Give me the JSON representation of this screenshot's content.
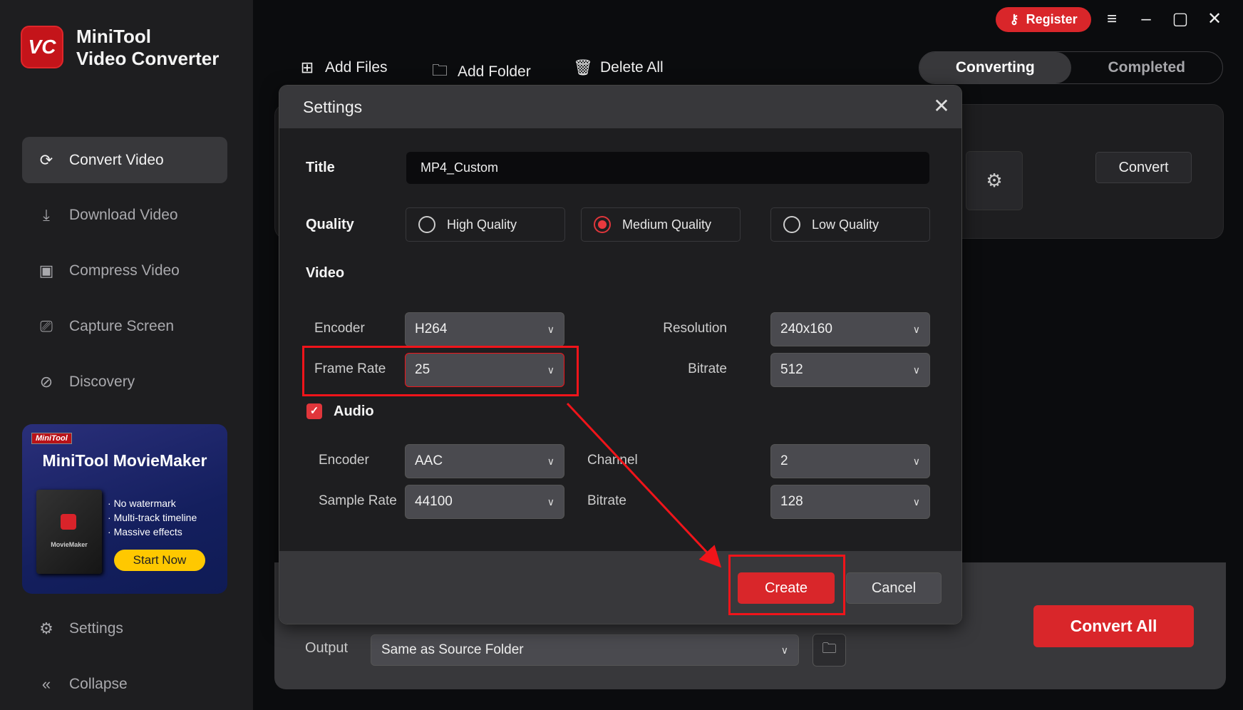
{
  "app": {
    "title_line1": "MiniTool",
    "title_line2": "Video Converter",
    "logo_text": "VC"
  },
  "sidebar": {
    "items": [
      {
        "label": "Convert Video",
        "icon": "convert-icon",
        "active": true
      },
      {
        "label": "Download Video",
        "icon": "download-icon"
      },
      {
        "label": "Compress Video",
        "icon": "compress-icon"
      },
      {
        "label": "Capture Screen",
        "icon": "camera-icon"
      },
      {
        "label": "Discovery",
        "icon": "compass-icon"
      }
    ],
    "settings": "Settings",
    "collapse": "Collapse"
  },
  "banner": {
    "brand": "MiniTool",
    "title": "MiniTool MovieMaker",
    "box_label": "MovieMaker",
    "features": [
      "No watermark",
      "Multi-track timeline",
      "Massive effects"
    ],
    "cta": "Start Now"
  },
  "toolbar": {
    "add_files": "Add Files",
    "add_folder": "Add Folder",
    "delete_all": "Delete All"
  },
  "tabs": {
    "converting": "Converting",
    "completed": "Completed"
  },
  "header": {
    "register": "Register"
  },
  "card": {
    "convert": "Convert"
  },
  "bottom": {
    "output_label": "Output",
    "output_value": "Same as Source Folder",
    "convert_all": "Convert All"
  },
  "dialog": {
    "title": "Settings",
    "title_label": "Title",
    "title_value": "MP4_Custom",
    "quality_label": "Quality",
    "quality_options": [
      "High Quality",
      "Medium Quality",
      "Low Quality"
    ],
    "quality_selected": "Medium Quality",
    "video_label": "Video",
    "video": {
      "encoder_label": "Encoder",
      "encoder": "H264",
      "resolution_label": "Resolution",
      "resolution": "240x160",
      "frame_rate_label": "Frame Rate",
      "frame_rate": "25",
      "bitrate_label": "Bitrate",
      "bitrate": "512"
    },
    "audio_label": "Audio",
    "audio_enabled": true,
    "audio": {
      "encoder_label": "Encoder",
      "encoder": "AAC",
      "channel_label": "Channel",
      "channel": "2",
      "sample_rate_label": "Sample Rate",
      "sample_rate": "44100",
      "bitrate_label": "Bitrate",
      "bitrate": "128"
    },
    "create": "Create",
    "cancel": "Cancel"
  },
  "colors": {
    "accent": "#d9262a",
    "highlight": "#f0141a"
  }
}
